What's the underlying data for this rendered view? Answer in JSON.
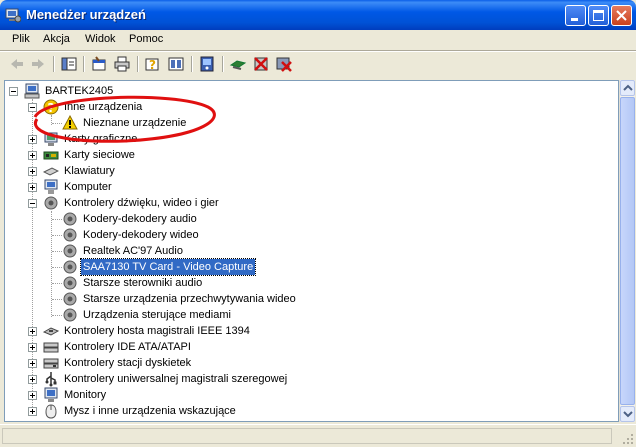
{
  "window": {
    "title": "Menedżer urządzeń"
  },
  "menu": [
    "Plik",
    "Akcja",
    "Widok",
    "Pomoc"
  ],
  "toolbar": {
    "buttons": [
      "back",
      "forward",
      "show-hide-console-tree",
      "properties",
      "print",
      "help",
      "view",
      "scan-hardware",
      "update-driver",
      "disable-device",
      "uninstall-device"
    ]
  },
  "tree": {
    "root": "BARTEK2405",
    "items": [
      {
        "label": "Inne urządzenia",
        "icon": "question-icon",
        "expanded": true
      },
      {
        "label": "Nieznane urządzenie",
        "icon": "warning-device-icon",
        "child": true
      },
      {
        "label": "Karty graficzne",
        "icon": "display-adapter-icon"
      },
      {
        "label": "Karty sieciowe",
        "icon": "network-card-icon"
      },
      {
        "label": "Klawiatury",
        "icon": "keyboard-icon"
      },
      {
        "label": "Komputer",
        "icon": "computer-icon"
      },
      {
        "label": "Kontrolery dźwięku, wideo i gier",
        "icon": "sound-icon",
        "expanded": true
      },
      {
        "label": "Kodery-dekodery audio",
        "icon": "sound-icon",
        "child": true
      },
      {
        "label": "Kodery-dekodery wideo",
        "icon": "sound-icon",
        "child": true
      },
      {
        "label": "Realtek AC'97 Audio",
        "icon": "sound-icon",
        "child": true
      },
      {
        "label": "SAA7130 TV Card - Video Capture",
        "icon": "sound-icon",
        "child": true,
        "selected": true
      },
      {
        "label": "Starsze sterowniki audio",
        "icon": "sound-icon",
        "child": true
      },
      {
        "label": "Starsze urządzenia przechwytywania wideo",
        "icon": "sound-icon",
        "child": true
      },
      {
        "label": "Urządzenia sterujące mediami",
        "icon": "sound-icon",
        "child": true
      },
      {
        "label": "Kontrolery hosta magistrali IEEE 1394",
        "icon": "ieee1394-icon"
      },
      {
        "label": "Kontrolery IDE ATA/ATAPI",
        "icon": "ide-controller-icon"
      },
      {
        "label": "Kontrolery stacji dyskietek",
        "icon": "floppy-controller-icon"
      },
      {
        "label": "Kontrolery uniwersalnej magistrali szeregowej",
        "icon": "usb-icon"
      },
      {
        "label": "Monitory",
        "icon": "monitor-icon"
      },
      {
        "label": "Mysz i inne urządzenia wskazujące",
        "icon": "mouse-icon"
      }
    ]
  },
  "colors": {
    "selection": "#316ac5",
    "annotation": "#e01010",
    "title_bar": "#0058e6"
  }
}
